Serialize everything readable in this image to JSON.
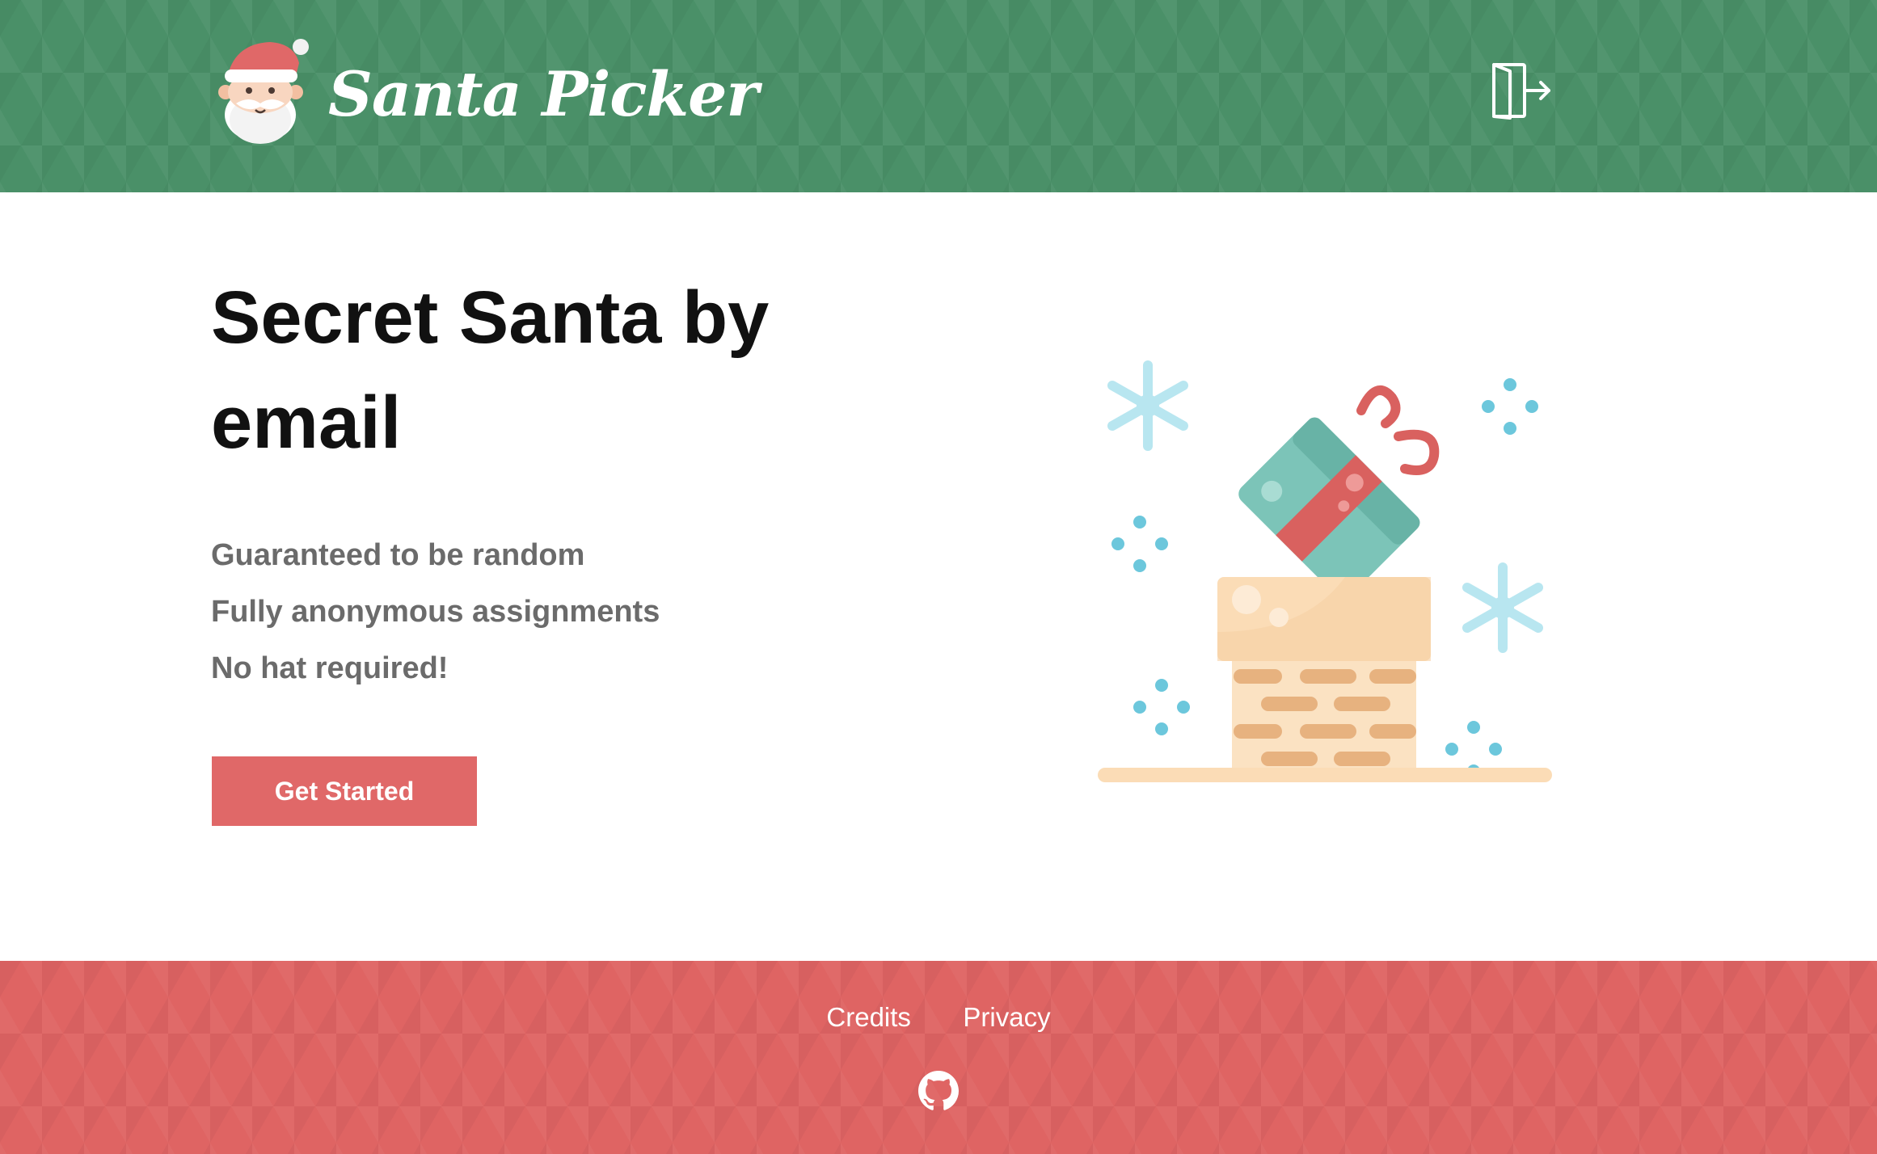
{
  "header": {
    "brand": "Santa Picker",
    "logo_icon": "santa-face-icon",
    "logout_icon": "logout-icon",
    "background_color": "#4a9068"
  },
  "hero": {
    "headline": "Secret Santa by email",
    "features": [
      "Guaranteed to be random",
      "Fully anonymous assignments",
      "No hat required!"
    ],
    "cta_label": "Get Started",
    "cta_color": "#e06868",
    "illustration": "gift-in-chimney-with-snowflakes"
  },
  "footer": {
    "links": [
      "Credits",
      "Privacy"
    ],
    "github_icon": "github-icon",
    "background_color": "#df6463"
  }
}
